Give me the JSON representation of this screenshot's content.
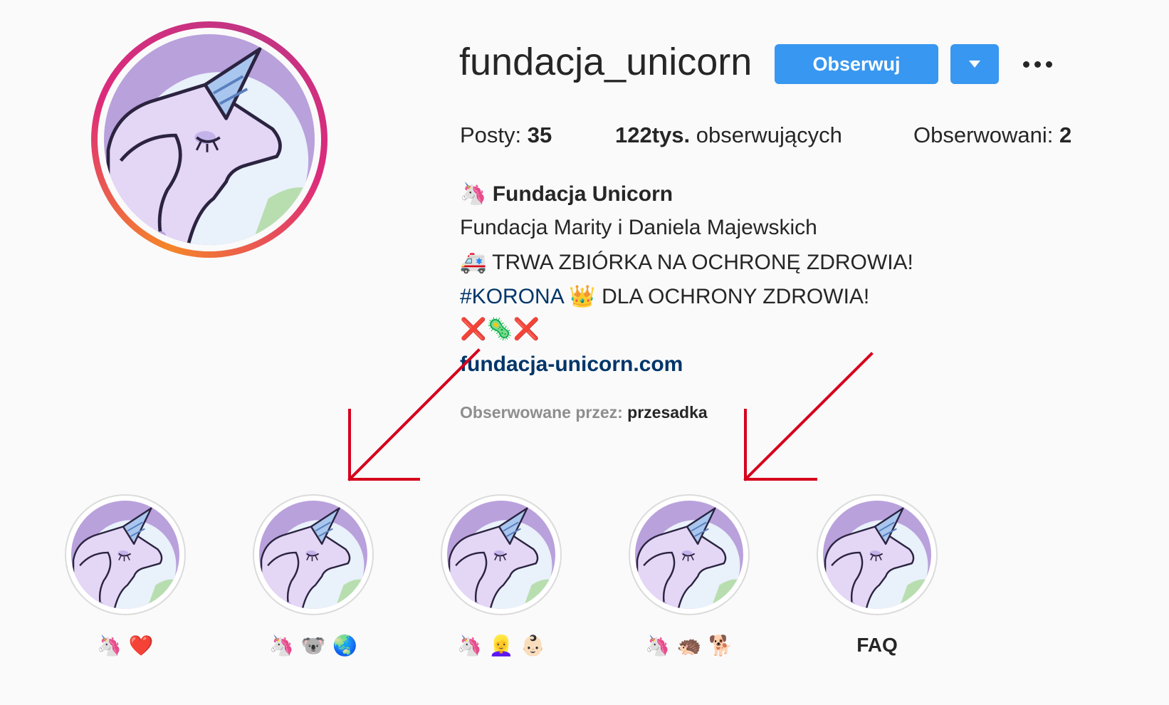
{
  "profile": {
    "username": "fundacja_unicorn",
    "follow_label": "Obserwuj",
    "stats": {
      "posts_label": "Posty:",
      "posts_value": "35",
      "followers_value": "122tys.",
      "followers_label": "obserwujących",
      "following_label": "Obserwowani:",
      "following_value": "2"
    },
    "bio": {
      "name_emoji": "🦄",
      "name": "Fundacja Unicorn",
      "line1": "Fundacja Marity i Daniela Majewskich",
      "line2_emoji": "🚑",
      "line2": "TRWA ZBIÓRKA NA OCHRONĘ ZDROWIA!",
      "line3_hashtag": "#KORONA",
      "line3_emoji": "👑",
      "line3": "DLA OCHRONY ZDROWIA!",
      "line4": "❌🦠❌",
      "link": "fundacja-unicorn.com",
      "followed_by_label": "Obserwowane przez:",
      "followed_by_user": "przesadka"
    }
  },
  "highlights": [
    {
      "label": "🦄 ❤️"
    },
    {
      "label": "🦄 🐨 🌏"
    },
    {
      "label": "🦄 👱‍♀️ 👶🏻"
    },
    {
      "label": "🦄 🦔 🐕"
    },
    {
      "label": "FAQ"
    }
  ],
  "colors": {
    "accent": "#3897f0",
    "link": "#003569",
    "arrow": "#d6001c",
    "unicorn_bg": "#b49ad8",
    "unicorn_body": "#e8dcf7",
    "horn": "#8fb6e6"
  },
  "icons": {
    "dropdown": "chevron-down-icon",
    "more": "more-horizontal-icon"
  }
}
